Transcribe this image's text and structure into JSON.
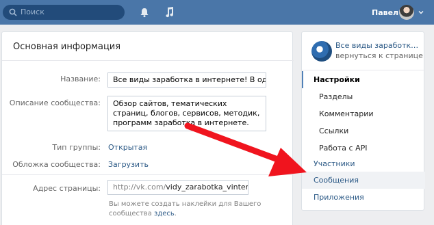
{
  "topbar": {
    "search_placeholder": "Поиск",
    "user_name": "Павел",
    "colors": {
      "bar": "#4a76a8",
      "search_bg": "#224b7a"
    },
    "icons": [
      "search-icon",
      "bell-icon",
      "music-icon",
      "chevron-down-icon"
    ]
  },
  "main": {
    "title": "Основная информация",
    "name_label": "Название:",
    "name_value": "Все виды заработка в интернете! В одном мес",
    "description_label": "Описание сообщества:",
    "description_value": "Обзор  сайтов, тематических страниц, блогов, сервисов, методик, программ заработка в интернете.",
    "type_label": "Тип группы:",
    "type_value": "Открытая",
    "cover_label": "Обложка сообщества:",
    "cover_value": "Загрузить",
    "address_label": "Адрес страницы:",
    "address_prefix": "http://vk.com/",
    "address_value": "vidy_zarabotka_vinternete",
    "hint_text": "Вы можете создать наклейки для Вашего сообщества",
    "hint_link": "здесь"
  },
  "sidebar": {
    "group_name": "Все виды заработка в интернете",
    "back_link": "вернуться к странице",
    "items": [
      {
        "label": "Настройки",
        "state": "active"
      },
      {
        "label": "Разделы",
        "state": "sub"
      },
      {
        "label": "Комментарии",
        "state": "sub"
      },
      {
        "label": "Ссылки",
        "state": "sub"
      },
      {
        "label": "Работа с API",
        "state": "sub"
      },
      {
        "label": "Участники",
        "state": "normal"
      },
      {
        "label": "Сообщения",
        "state": "hover"
      },
      {
        "label": "Приложения",
        "state": "normal"
      }
    ]
  },
  "annotation": {
    "arrow_color": "#f0141e",
    "arrow_icon": "red-arrow-annotation"
  }
}
